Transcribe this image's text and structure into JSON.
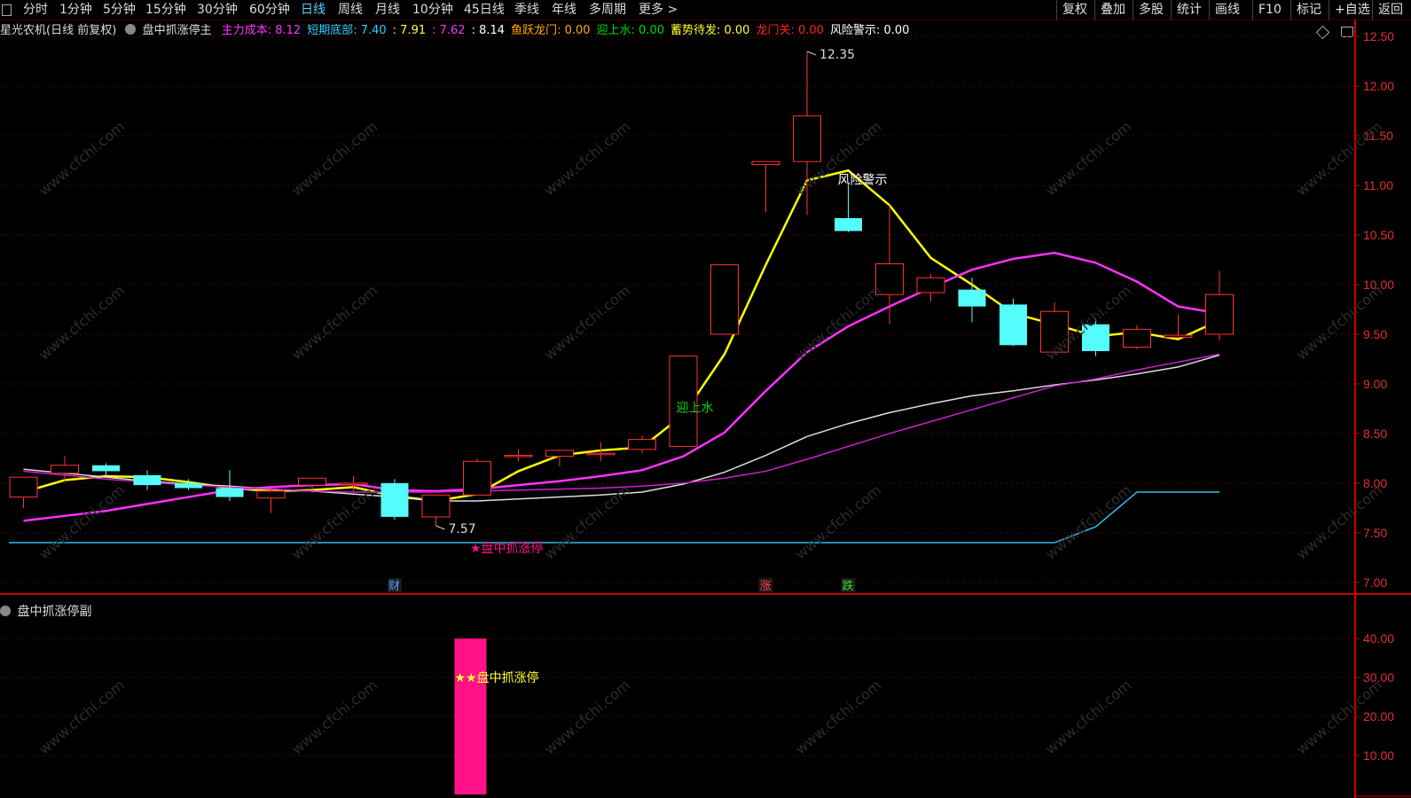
{
  "toolbar": {
    "left_items": [
      "分时",
      "1分钟",
      "5分钟",
      "15分钟",
      "30分钟",
      "60分钟",
      "日线",
      "周线",
      "月线",
      "10分钟",
      "45日线",
      "季线",
      "年线",
      "多周期",
      "更多 >"
    ],
    "active_item": "日线",
    "right_items": [
      "复权",
      "叠加",
      "多股",
      "统计",
      "画线",
      "F10",
      "标记",
      "+自选",
      "返回"
    ]
  },
  "main_header": {
    "stock": "星光农机(日线 前复权)",
    "formula": "盘中抓涨停主",
    "indicators": [
      {
        "text": "主力成本: 8.12",
        "color": "#ff33ff"
      },
      {
        "text": "短期底部: 7.40",
        "color": "#33ccff"
      },
      {
        "text": ": 7.91",
        "color": "#ffff33"
      },
      {
        "text": ": 7.62",
        "color": "#ff33ff"
      },
      {
        "text": ": 8.14",
        "color": "#ffffff"
      },
      {
        "text": "鱼跃龙门: 0.00",
        "color": "#ffaa00"
      },
      {
        "text": "迎上水: 0.00",
        "color": "#00dd00"
      },
      {
        "text": "蓄势待发: 0.00",
        "color": "#ffff33"
      },
      {
        "text": "龙门关: 0.00",
        "color": "#ff2222"
      },
      {
        "text": "风险警示: 0.00",
        "color": "#ffffff"
      }
    ]
  },
  "sub_header": {
    "formula": "盘中抓涨停副"
  },
  "colors": {
    "up": "#ff3333",
    "down": "#54fcfc",
    "ma5": "#ffff00",
    "ma10": "#ff33ff",
    "ma20": "#dddddd",
    "ma60": "#cc22cc",
    "support": "#33bbee",
    "signal_bar": "#ff1188",
    "axis": "#cc0000"
  },
  "chart_data": [
    {
      "type": "candlestick",
      "ylim": [
        6.9,
        12.6
      ],
      "y_ticks": [
        "12.50",
        "12.00",
        "11.50",
        "11.00",
        "10.50",
        "10.00",
        "9.50",
        "9.00",
        "8.50",
        "8.00",
        "7.50",
        "7.00"
      ],
      "y_tick_values": [
        12.5,
        12.0,
        11.5,
        11.0,
        10.5,
        10.0,
        9.5,
        9.0,
        8.5,
        8.0,
        7.5,
        7.0
      ],
      "candles": [
        {
          "o": 7.86,
          "h": 8.06,
          "l": 7.75,
          "c": 8.06
        },
        {
          "o": 8.1,
          "h": 8.27,
          "l": 8.02,
          "c": 8.18
        },
        {
          "o": 8.18,
          "h": 8.2,
          "l": 8.08,
          "c": 8.12
        },
        {
          "o": 8.08,
          "h": 8.13,
          "l": 7.93,
          "c": 7.98
        },
        {
          "o": 8.0,
          "h": 8.04,
          "l": 7.93,
          "c": 7.95
        },
        {
          "o": 7.95,
          "h": 8.13,
          "l": 7.82,
          "c": 7.86
        },
        {
          "o": 7.85,
          "h": 7.95,
          "l": 7.7,
          "c": 7.92
        },
        {
          "o": 7.98,
          "h": 8.05,
          "l": 7.9,
          "c": 8.05
        },
        {
          "o": 8.0,
          "h": 8.07,
          "l": 7.92,
          "c": 8.0
        },
        {
          "o": 8.0,
          "h": 8.04,
          "l": 7.63,
          "c": 7.66
        },
        {
          "o": 7.66,
          "h": 7.88,
          "l": 7.57,
          "c": 7.88
        },
        {
          "o": 7.88,
          "h": 8.25,
          "l": 7.88,
          "c": 8.22
        },
        {
          "o": 8.28,
          "h": 8.34,
          "l": 8.22,
          "c": 8.28
        },
        {
          "o": 8.27,
          "h": 8.34,
          "l": 8.17,
          "c": 8.33
        },
        {
          "o": 8.3,
          "h": 8.41,
          "l": 8.22,
          "c": 8.3
        },
        {
          "o": 8.34,
          "h": 8.48,
          "l": 8.3,
          "c": 8.44
        },
        {
          "o": 8.37,
          "h": 9.28,
          "l": 8.37,
          "c": 9.28
        },
        {
          "o": 9.5,
          "h": 10.2,
          "l": 9.5,
          "c": 10.2
        },
        {
          "o": 11.21,
          "h": 11.24,
          "l": 10.73,
          "c": 11.24
        },
        {
          "o": 11.24,
          "h": 12.35,
          "l": 10.7,
          "c": 11.7
        },
        {
          "o": 10.67,
          "h": 11.0,
          "l": 10.53,
          "c": 10.54
        },
        {
          "o": 9.9,
          "h": 10.8,
          "l": 9.6,
          "c": 10.21
        },
        {
          "o": 9.92,
          "h": 10.11,
          "l": 9.83,
          "c": 10.07
        },
        {
          "o": 9.95,
          "h": 10.07,
          "l": 9.62,
          "c": 9.78
        },
        {
          "o": 9.8,
          "h": 9.86,
          "l": 9.38,
          "c": 9.39
        },
        {
          "o": 9.32,
          "h": 9.82,
          "l": 9.31,
          "c": 9.73
        },
        {
          "o": 9.6,
          "h": 9.66,
          "l": 9.28,
          "c": 9.33
        },
        {
          "o": 9.37,
          "h": 9.59,
          "l": 9.35,
          "c": 9.55
        },
        {
          "o": 9.47,
          "h": 9.7,
          "l": 9.46,
          "c": 9.49
        },
        {
          "o": 9.5,
          "h": 10.14,
          "l": 9.44,
          "c": 9.9
        }
      ],
      "series": [
        {
          "name": "",
          "color_key": "ma5",
          "values": [
            7.91,
            8.03,
            8.07,
            8.06,
            8.01,
            7.95,
            7.92,
            7.93,
            7.96,
            7.87,
            7.82,
            7.89,
            8.12,
            8.28,
            8.33,
            8.36,
            8.69,
            9.3,
            10.2,
            11.05,
            11.15,
            10.8,
            10.27,
            10.0,
            9.71,
            9.6,
            9.48,
            9.52,
            9.45,
            9.64
          ]
        },
        {
          "name": "",
          "color_key": "ma10",
          "values": [
            7.62,
            7.67,
            7.72,
            7.79,
            7.86,
            7.93,
            7.96,
            7.98,
            7.99,
            7.93,
            7.92,
            7.94,
            7.98,
            8.02,
            8.07,
            8.13,
            8.27,
            8.51,
            8.93,
            9.32,
            9.58,
            9.78,
            9.97,
            10.15,
            10.26,
            10.32,
            10.22,
            10.03,
            9.78,
            9.71
          ]
        },
        {
          "name": "",
          "color_key": "ma20",
          "values": [
            8.14,
            8.1,
            8.06,
            8.02,
            7.99,
            7.97,
            7.94,
            7.92,
            7.89,
            7.86,
            7.82,
            7.82,
            7.84,
            7.86,
            7.88,
            7.91,
            7.99,
            8.11,
            8.28,
            8.47,
            8.6,
            8.71,
            8.8,
            8.88,
            8.93,
            8.99,
            9.04,
            9.1,
            9.17,
            9.29
          ]
        },
        {
          "name": "",
          "color_key": "ma60",
          "values": [
            8.12,
            8.08,
            8.04,
            8.01,
            7.98,
            7.96,
            7.94,
            7.92,
            7.91,
            7.91,
            7.91,
            7.92,
            7.93,
            7.94,
            7.95,
            7.97,
            8.0,
            8.05,
            8.12,
            8.24,
            8.37,
            8.5,
            8.62,
            8.74,
            8.86,
            8.98,
            9.05,
            9.14,
            9.22,
            9.3
          ]
        },
        {
          "name": "",
          "color_key": "support",
          "values": [
            7.4,
            7.4,
            7.4,
            7.4,
            7.4,
            7.4,
            7.4,
            7.4,
            7.4,
            7.4,
            7.4,
            7.4,
            7.4,
            7.4,
            7.4,
            7.4,
            7.4,
            7.4,
            7.4,
            7.4,
            7.4,
            7.4,
            7.4,
            7.4,
            7.4,
            7.4,
            7.56,
            7.91,
            7.91,
            7.91,
            7.93
          ]
        }
      ],
      "annotations": [
        {
          "text": "12.35",
          "candle": 19,
          "value": 12.35,
          "color": "#dddddd"
        },
        {
          "text": "7.57",
          "candle": 10,
          "value": 7.57,
          "color": "#dddddd"
        },
        {
          "text": "风险警示",
          "candle": 20,
          "value": 11.05,
          "color": "#ffffff"
        },
        {
          "text": "迎上水",
          "candle": 16,
          "value": 8.72,
          "color": "#00dd00"
        },
        {
          "text": "★盘中抓涨停",
          "candle": 11,
          "value": 7.3,
          "color": "#ff1188"
        }
      ],
      "event_markers": [
        {
          "text": "财",
          "candle": 9,
          "color": "#5aa0ff"
        },
        {
          "text": "涨",
          "candle": 18,
          "color": "#ff4444"
        },
        {
          "text": "跌",
          "candle": 20,
          "color": "#33dd33"
        }
      ]
    },
    {
      "type": "bar",
      "ylim": [
        0,
        48
      ],
      "y_ticks": [
        "40.00",
        "30.00",
        "20.00",
        "10.00"
      ],
      "y_tick_values": [
        40,
        30,
        20,
        10
      ],
      "bars": [
        {
          "candle": 11,
          "value": 40
        }
      ],
      "label": "★★盘中抓涨停"
    }
  ],
  "watermark": "www.cfchi.com"
}
